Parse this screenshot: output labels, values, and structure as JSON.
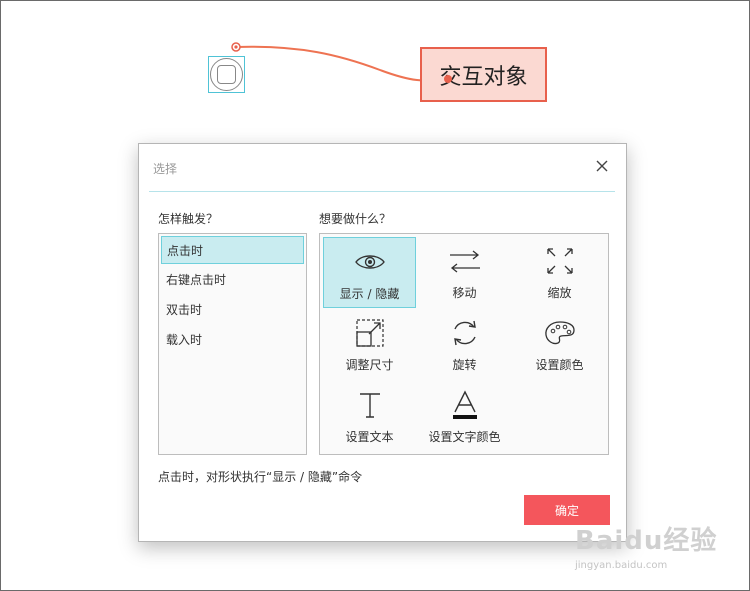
{
  "canvas": {
    "interactive_object_label": "交互对象",
    "connector_color": "#ee7352"
  },
  "dialog": {
    "title": "选择",
    "close_icon": "close-icon",
    "trigger_section_label": "怎样触发？",
    "action_section_label": "想要做什么？",
    "triggers": [
      {
        "label": "点击时",
        "selected": true
      },
      {
        "label": "右键点击时",
        "selected": false
      },
      {
        "label": "双击时",
        "selected": false
      },
      {
        "label": "载入时",
        "selected": false
      }
    ],
    "actions": [
      {
        "label": "显示 / 隐藏",
        "icon": "eye-icon",
        "selected": true
      },
      {
        "label": "移动",
        "icon": "move-arrows-icon",
        "selected": false
      },
      {
        "label": "缩放",
        "icon": "scale-arrows-icon",
        "selected": false
      },
      {
        "label": "调整尺寸",
        "icon": "resize-icon",
        "selected": false
      },
      {
        "label": "旋转",
        "icon": "rotate-icon",
        "selected": false
      },
      {
        "label": "设置颜色",
        "icon": "palette-icon",
        "selected": false
      },
      {
        "label": "设置文本",
        "icon": "text-icon",
        "selected": false
      },
      {
        "label": "设置文字颜色",
        "icon": "text-color-icon",
        "selected": false
      }
    ],
    "status_text": "点击时，对形状执行“显示 / 隐藏”命令",
    "ok_label": "确定",
    "accent_color": "#f4565c",
    "selection_color": "#c9ecf0"
  },
  "watermark": {
    "main": "Baidu经验",
    "sub": "jingyan.baidu.com"
  }
}
